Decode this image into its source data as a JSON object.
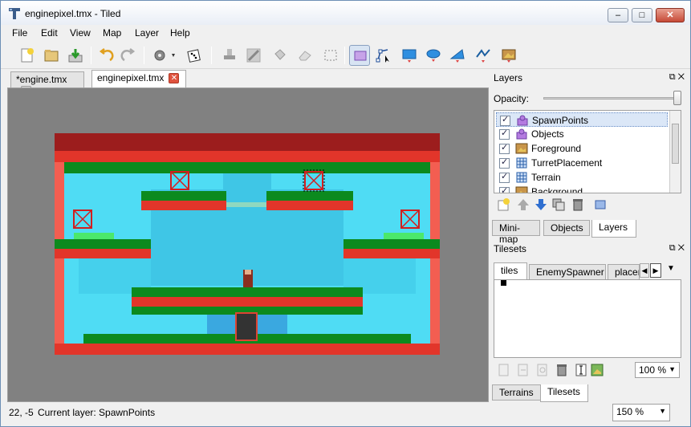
{
  "window": {
    "title": "enginepixel.tmx - Tiled",
    "minimize_label": "–",
    "maximize_label": "□",
    "close_label": "✕"
  },
  "menu": [
    "File",
    "Edit",
    "View",
    "Map",
    "Layer",
    "Help"
  ],
  "toolbar": {
    "tools": [
      "new-icon",
      "open-icon",
      "save-icon",
      "undo-icon",
      "redo-icon",
      "command-gear-icon",
      "random-dice-icon",
      "stamp-brush-icon",
      "terrain-brush-icon",
      "bucket-fill-icon",
      "eraser-icon",
      "rect-select-icon",
      "select-objects-icon",
      "edit-polygon-icon",
      "insert-rectangle-icon",
      "insert-ellipse-icon",
      "insert-polygon-icon",
      "insert-polyline-icon",
      "insert-tile-icon"
    ],
    "active_tool": "select-objects-icon"
  },
  "document_tabs": [
    {
      "label": "*engine.tmx",
      "active": false
    },
    {
      "label": "enginepixel.tmx",
      "active": true
    }
  ],
  "layers_panel": {
    "title": "Layers",
    "opacity_label": "Opacity:",
    "layers": [
      {
        "name": "SpawnPoints",
        "type": "object",
        "visible": true,
        "selected": true
      },
      {
        "name": "Objects",
        "type": "object",
        "visible": true,
        "selected": false
      },
      {
        "name": "Foreground",
        "type": "image",
        "visible": true,
        "selected": false
      },
      {
        "name": "TurretPlacement",
        "type": "tile",
        "visible": true,
        "selected": false
      },
      {
        "name": "Terrain",
        "type": "tile",
        "visible": true,
        "selected": false
      },
      {
        "name": "Background",
        "type": "image",
        "visible": true,
        "selected": false
      }
    ],
    "tabs": [
      "Mini-map",
      "Objects",
      "Layers"
    ],
    "active_tab": "Layers"
  },
  "tilesets_panel": {
    "title": "Tilesets",
    "tabs": [
      "tiles",
      "EnemySpawner",
      "placer"
    ],
    "active_tab": "tiles",
    "zoom": "100 %",
    "bottom_tabs": [
      "Terrains",
      "Tilesets"
    ],
    "active_bottom_tab": "Tilesets"
  },
  "status": {
    "coords": "22, -5",
    "current_layer": "Current layer: SpawnPoints",
    "zoom": "150 %"
  },
  "colors": {
    "canvas_bg": "#818181",
    "sky": "#4fdcf4",
    "girder": "#e2352a",
    "grass": "#0c8a1e",
    "selection": "#dbe7f7"
  }
}
